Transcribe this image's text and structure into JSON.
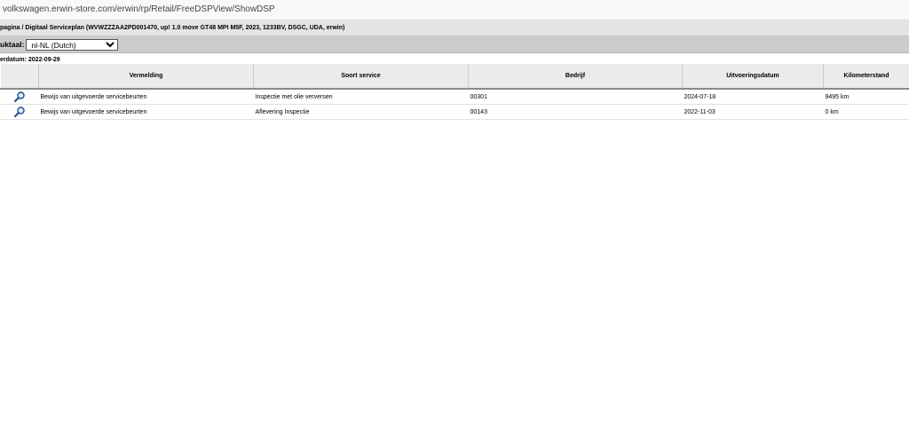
{
  "browser": {
    "url": "volkswagen.erwin-store.com/erwin/rp/Retail/FreeDSPView/ShowDSP"
  },
  "header": {
    "breadcrumb": "pagina / Digitaal Serviceplan (WVWZZZAA2PD001470, up! 1.0 move GT48 MPI M5F, 2023, 1233BV, DSGC, UDA, erwin)"
  },
  "language": {
    "label": "uktaal:",
    "selected": "nl-NL (Dutch)"
  },
  "date_line": "erdatum: 2022-09-29",
  "table": {
    "columns": [
      "Vermelding",
      "Soort service",
      "Bedrijf",
      "Uitvoeringsdatum",
      "Kilometerstand"
    ],
    "rows": [
      {
        "icon": "magnifier-icon",
        "vermelding": "Bewijs van uitgevoerde servicebeurten",
        "soort": "Inspectie met olie verversen",
        "bedrijf": "00301",
        "datum": "2024-07-18",
        "km": "9495 km"
      },
      {
        "icon": "magnifier-icon",
        "vermelding": "Bewijs van uitgevoerde servicebeurten",
        "soort": "Aflevering Inspectie",
        "bedrijf": "00143",
        "datum": "2022-11-03",
        "km": "0 km"
      }
    ]
  },
  "colors": {
    "header_bg": "#ebebeb",
    "breadcrumb_bg": "#e4e4e4",
    "langbar_bg": "#cccccc",
    "icon_blue": "#1a4f8a"
  }
}
